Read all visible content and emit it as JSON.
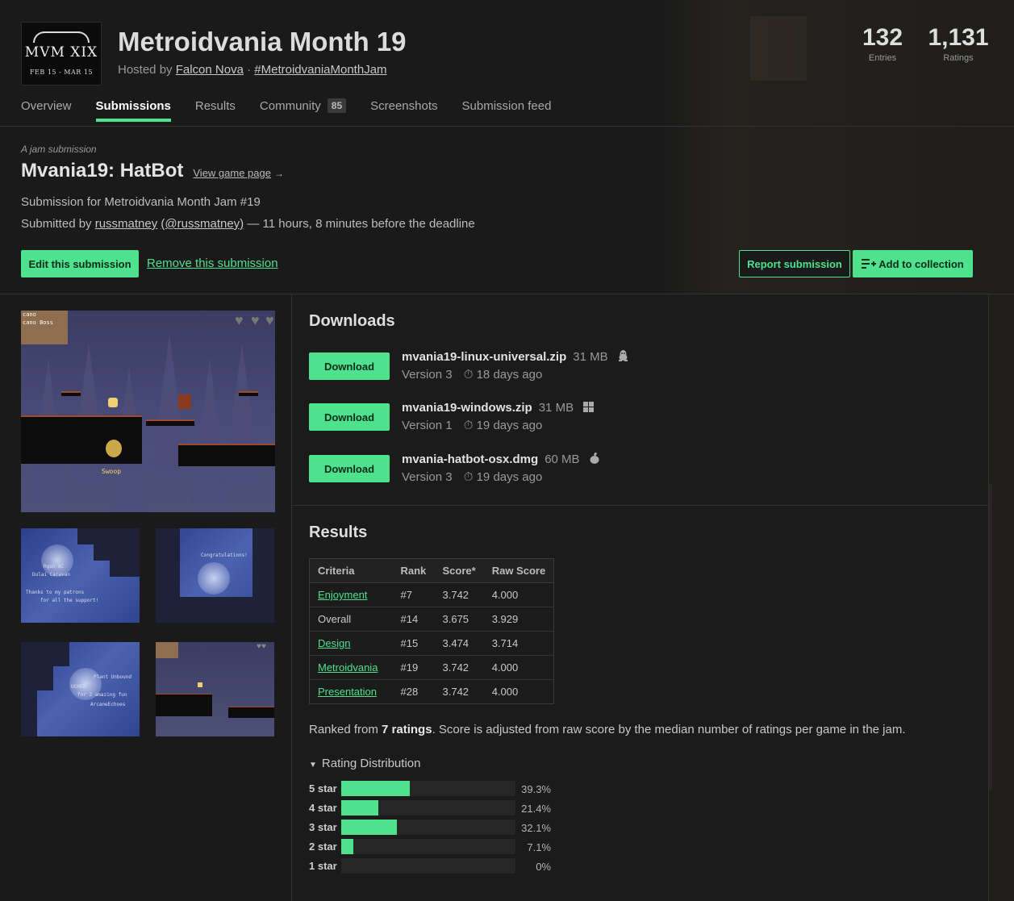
{
  "jam": {
    "logo_title": "MVM XIX",
    "logo_dates": "FEB 15 - MAR 15",
    "title": "Metroidvania Month 19",
    "hosted_prefix": "Hosted by",
    "host": "Falcon Nova",
    "separator": "·",
    "hashtag": "#MetroidvaniaMonthJam",
    "entries_count": "132",
    "entries_label": "Entries",
    "ratings_count": "1,131",
    "ratings_label": "Ratings"
  },
  "tabs": [
    {
      "label": "Overview"
    },
    {
      "label": "Submissions"
    },
    {
      "label": "Results"
    },
    {
      "label": "Community",
      "badge": "85"
    },
    {
      "label": "Screenshots"
    },
    {
      "label": "Submission feed"
    }
  ],
  "submission": {
    "kicker": "A jam submission",
    "title": "Mvania19: HatBot",
    "view_game_page": "View game page",
    "view_arrow": "→",
    "description": "Submission for Metroidvania Month Jam #19",
    "submitted_prefix": "Submitted by",
    "author": "russmatney",
    "author_handle": "(@russmatney)",
    "deadline_text": "— 11 hours, 8 minutes before the deadline"
  },
  "actions": {
    "edit": "Edit this submission",
    "remove": "Remove this submission",
    "report": "Report submission",
    "add_collection": "Add to collection"
  },
  "screenshots": {
    "main_caption": "Swoop",
    "main_hud_1": "cano",
    "main_hud_2": "cano  Boss",
    "thumb1_lines": [
      "Rgan  AC",
      "Dulai  Caravan",
      "Thanks to my patrons",
      "for all the support!"
    ],
    "thumb2_lines": [
      "Congratulations!"
    ],
    "thumb3_lines": [
      "Plant Unbound",
      "UCHED",
      "for 2 amazing fun",
      "ArcaneEchoes"
    ]
  },
  "downloads": {
    "heading": "Downloads",
    "button_label": "Download",
    "items": [
      {
        "name": "mvania19-linux-universal.zip",
        "size": "31 MB",
        "platform_icon": "linux-icon",
        "version": "Version 3",
        "age": "18 days ago"
      },
      {
        "name": "mvania19-windows.zip",
        "size": "31 MB",
        "platform_icon": "windows-icon",
        "version": "Version 1",
        "age": "19 days ago"
      },
      {
        "name": "mvania-hatbot-osx.dmg",
        "size": "60 MB",
        "platform_icon": "apple-icon",
        "version": "Version 3",
        "age": "19 days ago"
      }
    ]
  },
  "results": {
    "heading": "Results",
    "columns": [
      "Criteria",
      "Rank",
      "Score*",
      "Raw Score"
    ],
    "rows": [
      {
        "criteria": "Enjoyment",
        "link": true,
        "rank": "#7",
        "score": "3.742",
        "raw": "4.000"
      },
      {
        "criteria": "Overall",
        "link": false,
        "rank": "#14",
        "score": "3.675",
        "raw": "3.929"
      },
      {
        "criteria": "Design",
        "link": true,
        "rank": "#15",
        "score": "3.474",
        "raw": "3.714"
      },
      {
        "criteria": "Metroidvania",
        "link": true,
        "rank": "#19",
        "score": "3.742",
        "raw": "4.000"
      },
      {
        "criteria": "Presentation",
        "link": true,
        "rank": "#28",
        "score": "3.742",
        "raw": "4.000"
      }
    ],
    "ranked_prefix": "Ranked from",
    "ranked_count": "7 ratings",
    "ranked_suffix": ". Score is adjusted from raw score by the median number of ratings per game in the jam."
  },
  "distribution": {
    "heading": "Rating Distribution",
    "toggle": "▼",
    "rows": [
      {
        "label": "5 star",
        "pct": "39.3%",
        "value": 39.3
      },
      {
        "label": "4 star",
        "pct": "21.4%",
        "value": 21.4
      },
      {
        "label": "3 star",
        "pct": "32.1%",
        "value": 32.1
      },
      {
        "label": "2 star",
        "pct": "7.1%",
        "value": 7.1
      },
      {
        "label": "1 star",
        "pct": "0%",
        "value": 0
      }
    ]
  },
  "colors": {
    "accent": "#4ee28f",
    "background": "#1a1a1a"
  }
}
